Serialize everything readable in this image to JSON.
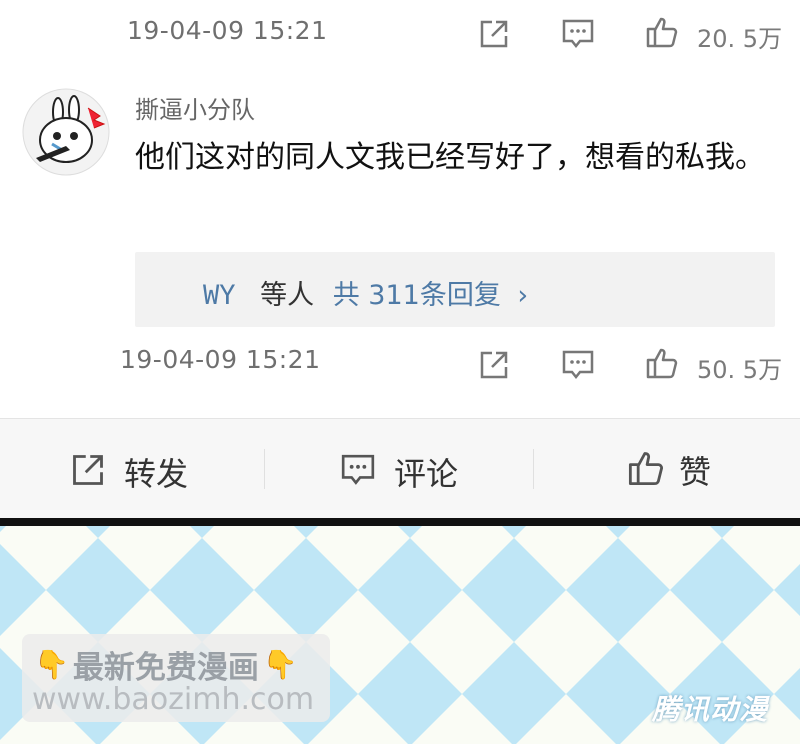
{
  "top_comment": {
    "timestamp": "19-04-09 15:21",
    "like_count": "20. 5万"
  },
  "comment": {
    "username": "撕逼小分队",
    "text": "他们这对的同人文我已经写好了，想看的私我。",
    "replies": {
      "user": "WY",
      "mid": "等人",
      "count_text": "共 311条回复",
      "chevron": "›"
    },
    "timestamp": "19-04-09 15:21",
    "like_count": "50. 5万"
  },
  "icons": {
    "share": "share-icon",
    "comment": "comment-icon",
    "like": "thumbs-up-icon"
  },
  "action_bar": {
    "repost_label": "转发",
    "comment_label": "评论",
    "like_label": "赞"
  },
  "watermark": {
    "line1": "最新免费漫画",
    "line2": "www.baozimh.com",
    "emoji": "👇"
  },
  "brand": {
    "text": "腾讯动漫"
  },
  "colors": {
    "link_blue": "#4e7aa6",
    "checker_blue": "#bfe6f6",
    "checker_white": "#fafcf5"
  }
}
